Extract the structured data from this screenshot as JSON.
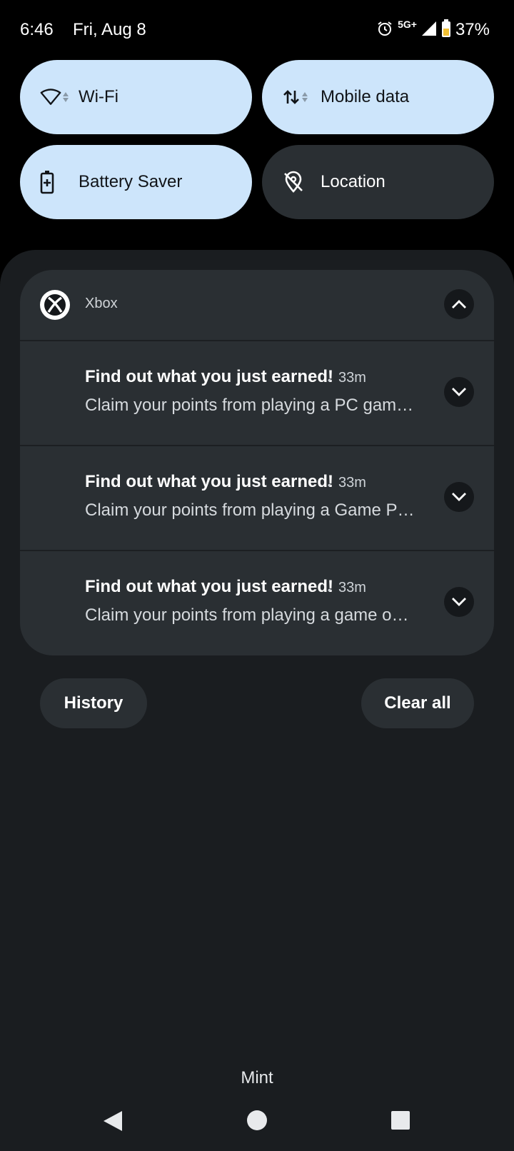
{
  "status_bar": {
    "time": "6:46",
    "date": "Fri, Aug 8",
    "network": "5G+",
    "battery_percent": "37%",
    "icons": [
      "alarm-icon",
      "signal-icon",
      "battery-icon"
    ]
  },
  "quick_settings": {
    "tiles": [
      {
        "label": "Wi-Fi",
        "icon": "wifi-icon",
        "state": "on"
      },
      {
        "label": "Mobile data",
        "icon": "mobile-data-icon",
        "state": "on"
      },
      {
        "label": "Battery Saver",
        "icon": "battery-saver-icon",
        "state": "on"
      },
      {
        "label": "Location",
        "icon": "location-off-icon",
        "state": "off"
      }
    ]
  },
  "notification_group": {
    "app_name": "Xbox",
    "app_icon": "xbox-icon",
    "notifications": [
      {
        "title": "Find out what you just earned!",
        "separator": "•",
        "time": "33m",
        "body": "Claim your points from playing a PC gam…"
      },
      {
        "title": "Find out what you just earned!",
        "separator": "•",
        "time": "33m",
        "body": "Claim your points from playing a Game P…"
      },
      {
        "title": "Find out what you just earned!",
        "separator": "•",
        "time": "33m",
        "body": "Claim your points from playing a game o…"
      }
    ]
  },
  "actions": {
    "history_label": "History",
    "clear_all_label": "Clear all"
  },
  "carrier_label": "Mint",
  "colors": {
    "tile_on": "#cde5fb",
    "tile_off": "#2a2f33",
    "shade": "#1a1d20",
    "card": "#2a2f33"
  }
}
